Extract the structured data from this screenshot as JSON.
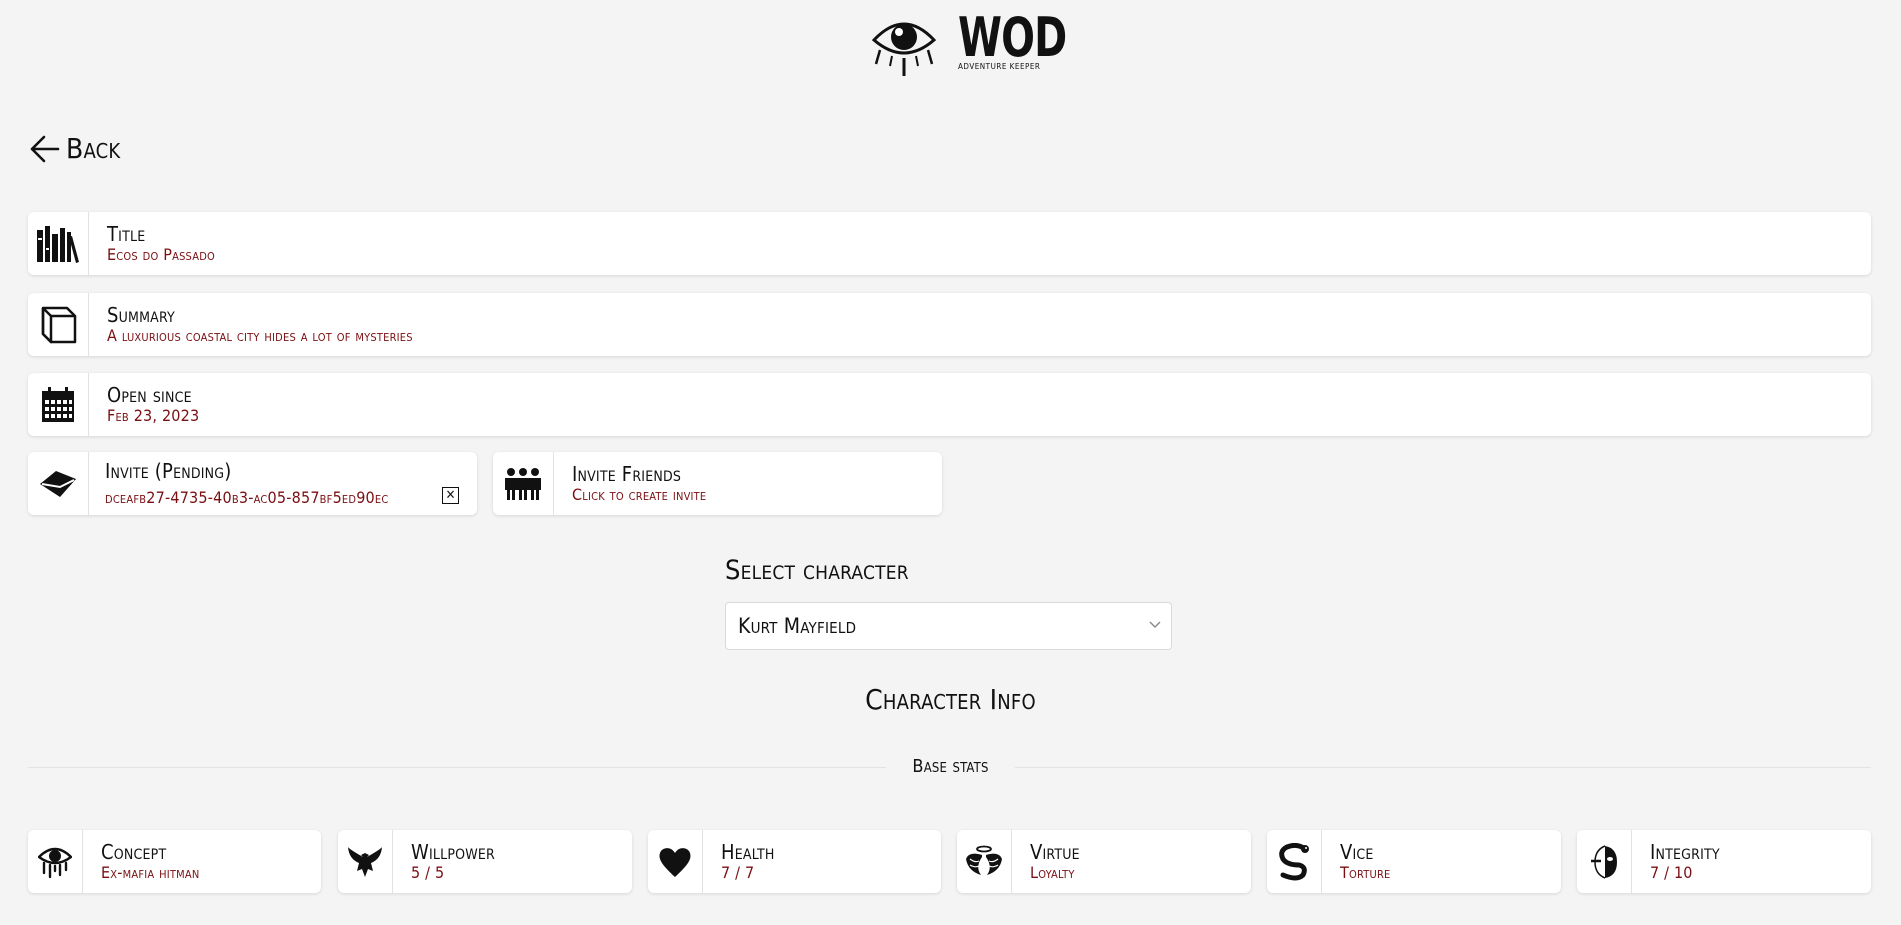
{
  "brand": {
    "name": "WOD",
    "tagline": "ADVENTURE KEEPER"
  },
  "back_label": "Back",
  "info_cards": [
    {
      "label": "Title",
      "value": "Ecos do Passado",
      "icon": "books-icon"
    },
    {
      "label": "Summary",
      "value": "A luxurious coastal city hides a lot of mysteries",
      "icon": "book-icon"
    },
    {
      "label": "Open since",
      "value": "Feb 23, 2023",
      "icon": "calendar-icon"
    }
  ],
  "invite_pending": {
    "label": "Invite (Pending)",
    "value": "dceafb27-4735-40b3-ac05-857bf5ed90ec",
    "icon": "envelope-icon"
  },
  "invite_friends": {
    "label": "Invite Friends",
    "value": "Click to create invite",
    "icon": "group-icon"
  },
  "select_character": {
    "label": "Select character",
    "value": "Kurt Mayfield"
  },
  "character_info_title": "Character Info",
  "base_stats_title": "Base stats",
  "stats": [
    {
      "label": "Concept",
      "value": "Ex-mafia hitman",
      "icon": "crying-eye-icon"
    },
    {
      "label": "Willpower",
      "value": "5 / 5",
      "icon": "eagle-icon"
    },
    {
      "label": "Health",
      "value": "7 / 7",
      "icon": "heart-icon"
    },
    {
      "label": "Virtue",
      "value": "Loyalty",
      "icon": "angel-wings-icon"
    },
    {
      "label": "Vice",
      "value": "Torture",
      "icon": "snake-icon"
    },
    {
      "label": "Integrity",
      "value": "7 / 10",
      "icon": "half-mask-icon"
    }
  ],
  "colors": {
    "accent": "#7a0f12",
    "background": "#f4f4f4",
    "card": "#ffffff"
  }
}
